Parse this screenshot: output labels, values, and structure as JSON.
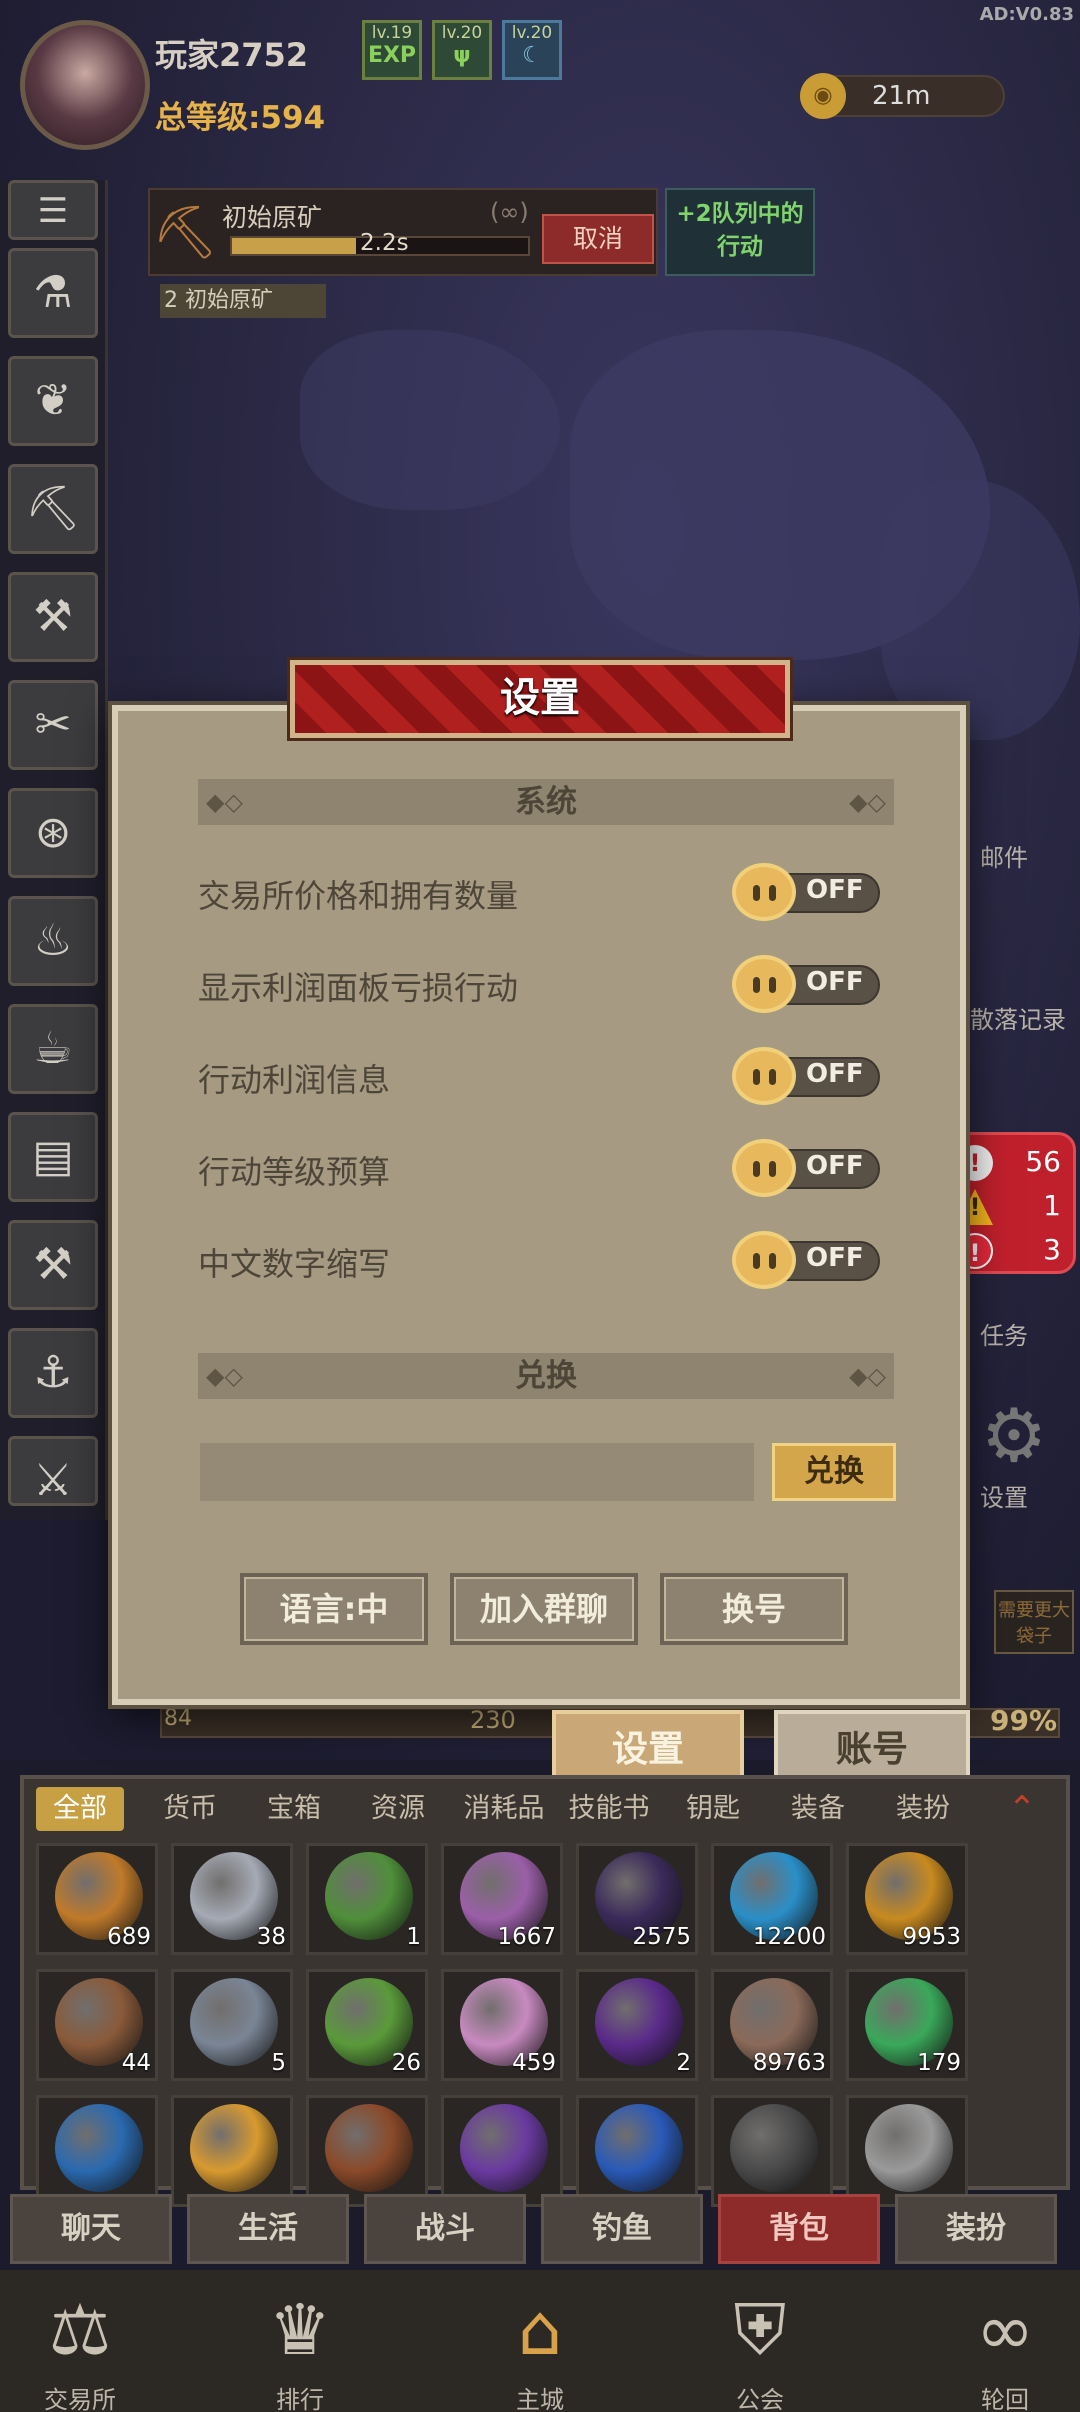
{
  "header": {
    "player_name": "玩家2752",
    "total_level": "总等级:594",
    "version": "AD:V0.83",
    "level_badges": [
      {
        "label": "lv.19",
        "icon": "EXP"
      },
      {
        "label": "lv.20",
        "icon": "ψ"
      },
      {
        "label": "lv.20",
        "icon": "☾"
      }
    ],
    "timer": "21m"
  },
  "action": {
    "name": "初始原矿",
    "repeat": "(∞)",
    "time": "2.2s",
    "progress": 0.42,
    "cancel_label": "取消",
    "queue_label_line1": "+2队列中的",
    "queue_label_line2": "行动",
    "queue_item": "2  初始原矿"
  },
  "sidebar": {
    "items": [
      "⚗",
      "❦",
      "⛏",
      "⚒",
      "✂",
      "⊛",
      "♨",
      "☕",
      "▤",
      "⚒",
      "⚓",
      "⚔"
    ]
  },
  "right_panel": {
    "mail": "邮件",
    "records": "散落记录",
    "tasks": "任务",
    "settings": "设置",
    "need_bigger_bag": "需要更大袋子",
    "alerts": [
      {
        "icon": "!",
        "count": "56"
      },
      {
        "icon": "!",
        "count": "1"
      },
      {
        "icon": "!",
        "count": "3"
      }
    ]
  },
  "dialog": {
    "title": "设置",
    "system_section": "系统",
    "settings": [
      {
        "label": "交易所价格和拥有数量",
        "state": "OFF"
      },
      {
        "label": "显示利润面板亏损行动",
        "state": "OFF"
      },
      {
        "label": "行动利润信息",
        "state": "OFF"
      },
      {
        "label": "行动等级预算",
        "state": "OFF"
      },
      {
        "label": "中文数字缩写",
        "state": "OFF"
      }
    ],
    "redeem_section": "兑换",
    "redeem_placeholder": "",
    "redeem_button": "兑换",
    "language_button": "语言:中",
    "join_group_button": "加入群聊",
    "switch_account_button": "换号"
  },
  "status": {
    "xp_left": "84",
    "xp_mid": "230",
    "xp_percent": "99%"
  },
  "bottom_buttons": {
    "settings": "设置",
    "account": "账号"
  },
  "inventory": {
    "tabs": [
      "全部",
      "货币",
      "宝箱",
      "资源",
      "消耗品",
      "技能书",
      "钥匙",
      "装备",
      "装扮"
    ],
    "active_tab": "全部",
    "rows": [
      [
        {
          "color": "#c07a2a",
          "count": "689"
        },
        {
          "color": "#a5aab5",
          "count": "38"
        },
        {
          "color": "#4f8f3a",
          "count": "1"
        },
        {
          "color": "#9b5fa8",
          "count": "1667"
        },
        {
          "color": "#3a2a5a",
          "count": "2575"
        },
        {
          "color": "#2a8fc8",
          "count": "12200"
        },
        {
          "color": "#c88a20",
          "count": "9953"
        }
      ],
      [
        {
          "color": "#8a5a3a",
          "count": "44"
        },
        {
          "color": "#7a8595",
          "count": "5"
        },
        {
          "color": "#5a9a3a",
          "count": "26"
        },
        {
          "color": "#c88ac0",
          "count": "459"
        },
        {
          "color": "#5a2a8a",
          "count": "2"
        },
        {
          "color": "#8a6a5a",
          "count": "89763"
        },
        {
          "color": "#3aa85a",
          "count": "179"
        }
      ],
      [
        {
          "color": "#2a6ab0",
          "count": ""
        },
        {
          "color": "#d89a30",
          "count": ""
        },
        {
          "color": "#8a4a2a",
          "count": ""
        },
        {
          "color": "#6a3aa0",
          "count": ""
        },
        {
          "color": "#2a5ab8",
          "count": ""
        },
        {
          "color": "#4a4a4a",
          "count": ""
        },
        {
          "color": "#9a9a9a",
          "count": ""
        }
      ]
    ]
  },
  "nav_tabs": [
    "聊天",
    "生活",
    "战斗",
    "钓鱼",
    "背包",
    "装扮"
  ],
  "active_nav": "背包",
  "footer": [
    {
      "label": "交易所",
      "icon": "⚖"
    },
    {
      "label": "排行",
      "icon": "♛"
    },
    {
      "label": "主城",
      "icon": "⌂"
    },
    {
      "label": "公会",
      "icon": "⛨"
    },
    {
      "label": "轮回",
      "icon": "∞"
    }
  ]
}
